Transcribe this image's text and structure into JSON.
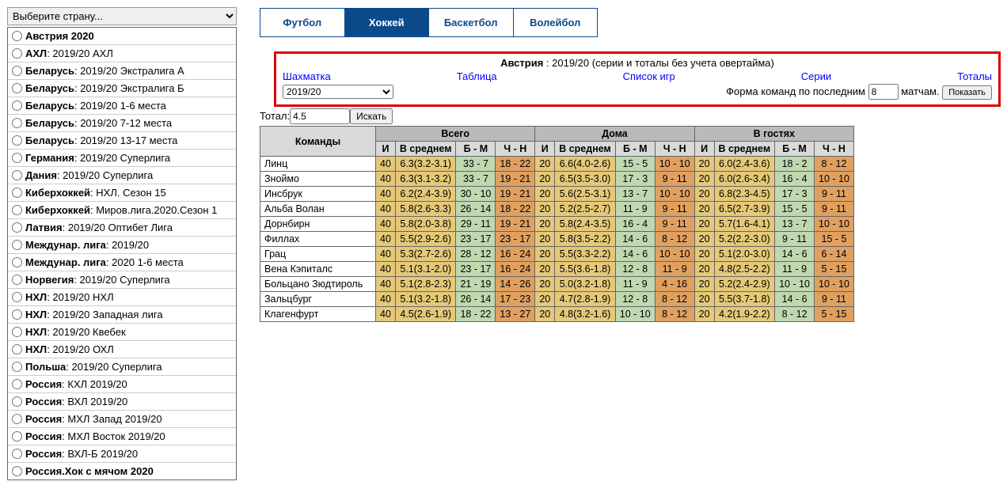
{
  "sidebar": {
    "dropdown": "Выберите страну...",
    "items": [
      {
        "b": "Австрия 2020",
        "rest": ""
      },
      {
        "b": "АХЛ",
        "rest": " : 2019/20 АХЛ"
      },
      {
        "b": "Беларусь",
        "rest": " : 2019/20 Экстралига А"
      },
      {
        "b": "Беларусь",
        "rest": " : 2019/20 Экстралига Б"
      },
      {
        "b": "Беларусь",
        "rest": " : 2019/20 1-6 места"
      },
      {
        "b": "Беларусь",
        "rest": " : 2019/20 7-12 места"
      },
      {
        "b": "Беларусь",
        "rest": " : 2019/20 13-17 места"
      },
      {
        "b": "Германия",
        "rest": " : 2019/20 Суперлига"
      },
      {
        "b": "Дания",
        "rest": " : 2019/20 Суперлига"
      },
      {
        "b": "Киберхоккей",
        "rest": " : НХЛ. Сезон 15"
      },
      {
        "b": "Киберхоккей",
        "rest": " : Миров.лига.2020.Сезон 1"
      },
      {
        "b": "Латвия",
        "rest": " : 2019/20 Оптибет Лига"
      },
      {
        "b": "Междунар. лига",
        "rest": " : 2019/20"
      },
      {
        "b": "Междунар. лига",
        "rest": " : 2020 1-6 места"
      },
      {
        "b": "Норвегия",
        "rest": " : 2019/20 Суперлига"
      },
      {
        "b": "НХЛ",
        "rest": " : 2019/20 НХЛ"
      },
      {
        "b": "НХЛ",
        "rest": " : 2019/20 Западная лига"
      },
      {
        "b": "НХЛ",
        "rest": " : 2019/20 Квебек"
      },
      {
        "b": "НХЛ",
        "rest": " : 2019/20 ОХЛ"
      },
      {
        "b": "Польша",
        "rest": " : 2019/20 Суперлига"
      },
      {
        "b": "Россия",
        "rest": " : КХЛ 2019/20"
      },
      {
        "b": "Россия",
        "rest": " : ВХЛ 2019/20"
      },
      {
        "b": "Россия",
        "rest": " : МХЛ Запад 2019/20"
      },
      {
        "b": "Россия",
        "rest": " : МХЛ Восток 2019/20"
      },
      {
        "b": "Россия",
        "rest": " : ВХЛ-Б 2019/20"
      },
      {
        "b": "Россия.Хок с мячом 2020",
        "rest": ""
      }
    ]
  },
  "tabs": {
    "football": "Футбол",
    "hockey": "Хоккей",
    "basketball": "Баскетбол",
    "volleyball": "Волейбол"
  },
  "ctrl": {
    "title_b": "Австрия",
    "title_rest": " : 2019/20 (серии и тоталы без учета овертайма)",
    "shakhmatka": "Шахматка",
    "table": "Таблица",
    "list": "Список игр",
    "series": "Серии",
    "totals": "Тоталы",
    "season": "2019/20",
    "form_prefix": "Форма команд по последним ",
    "form_value": "8",
    "form_suffix": " матчам. ",
    "show": "Показать"
  },
  "totbar": {
    "label": "Тотал:",
    "value": "4.5",
    "search": "Искать"
  },
  "table": {
    "group": [
      "Всего",
      "Дома",
      "В гостях"
    ],
    "sub": [
      "Команды",
      "И",
      "В среднем",
      "Б - М",
      "Ч - Н",
      "И",
      "В среднем",
      "Б - М",
      "Ч - Н",
      "И",
      "В среднем",
      "Б - М",
      "Ч - Н"
    ],
    "rows": [
      {
        "name": "Линц",
        "all": {
          "i": "40",
          "avg": "6.3(3.2-3.1)",
          "bm": "33 - 7",
          "chn": "18 - 22"
        },
        "home": {
          "i": "20",
          "avg": "6.6(4.0-2.6)",
          "bm": "15 - 5",
          "chn": "10 - 10"
        },
        "away": {
          "i": "20",
          "avg": "6.0(2.4-3.6)",
          "bm": "18 - 2",
          "chn": "8 - 12"
        }
      },
      {
        "name": "Зноймо",
        "all": {
          "i": "40",
          "avg": "6.3(3.1-3.2)",
          "bm": "33 - 7",
          "chn": "19 - 21"
        },
        "home": {
          "i": "20",
          "avg": "6.5(3.5-3.0)",
          "bm": "17 - 3",
          "chn": "9 - 11"
        },
        "away": {
          "i": "20",
          "avg": "6.0(2.6-3.4)",
          "bm": "16 - 4",
          "chn": "10 - 10"
        }
      },
      {
        "name": "Инсбрук",
        "all": {
          "i": "40",
          "avg": "6.2(2.4-3.9)",
          "bm": "30 - 10",
          "chn": "19 - 21"
        },
        "home": {
          "i": "20",
          "avg": "5.6(2.5-3.1)",
          "bm": "13 - 7",
          "chn": "10 - 10"
        },
        "away": {
          "i": "20",
          "avg": "6.8(2.3-4.5)",
          "bm": "17 - 3",
          "chn": "9 - 11"
        }
      },
      {
        "name": "Альба Волан",
        "all": {
          "i": "40",
          "avg": "5.8(2.6-3.3)",
          "bm": "26 - 14",
          "chn": "18 - 22"
        },
        "home": {
          "i": "20",
          "avg": "5.2(2.5-2.7)",
          "bm": "11 - 9",
          "chn": "9 - 11"
        },
        "away": {
          "i": "20",
          "avg": "6.5(2.7-3.9)",
          "bm": "15 - 5",
          "chn": "9 - 11"
        }
      },
      {
        "name": "Дорнбирн",
        "all": {
          "i": "40",
          "avg": "5.8(2.0-3.8)",
          "bm": "29 - 11",
          "chn": "19 - 21"
        },
        "home": {
          "i": "20",
          "avg": "5.8(2.4-3.5)",
          "bm": "16 - 4",
          "chn": "9 - 11"
        },
        "away": {
          "i": "20",
          "avg": "5.7(1.6-4.1)",
          "bm": "13 - 7",
          "chn": "10 - 10"
        }
      },
      {
        "name": "Филлах",
        "all": {
          "i": "40",
          "avg": "5.5(2.9-2.6)",
          "bm": "23 - 17",
          "chn": "23 - 17"
        },
        "home": {
          "i": "20",
          "avg": "5.8(3.5-2.2)",
          "bm": "14 - 6",
          "chn": "8 - 12"
        },
        "away": {
          "i": "20",
          "avg": "5.2(2.2-3.0)",
          "bm": "9 - 11",
          "chn": "15 - 5"
        }
      },
      {
        "name": "Грац",
        "all": {
          "i": "40",
          "avg": "5.3(2.7-2.6)",
          "bm": "28 - 12",
          "chn": "16 - 24"
        },
        "home": {
          "i": "20",
          "avg": "5.5(3.3-2.2)",
          "bm": "14 - 6",
          "chn": "10 - 10"
        },
        "away": {
          "i": "20",
          "avg": "5.1(2.0-3.0)",
          "bm": "14 - 6",
          "chn": "6 - 14"
        }
      },
      {
        "name": "Вена Кэпиталс",
        "all": {
          "i": "40",
          "avg": "5.1(3.1-2.0)",
          "bm": "23 - 17",
          "chn": "16 - 24"
        },
        "home": {
          "i": "20",
          "avg": "5.5(3.6-1.8)",
          "bm": "12 - 8",
          "chn": "11 - 9"
        },
        "away": {
          "i": "20",
          "avg": "4.8(2.5-2.2)",
          "bm": "11 - 9",
          "chn": "5 - 15"
        }
      },
      {
        "name": "Больцано Зюдтироль",
        "all": {
          "i": "40",
          "avg": "5.1(2.8-2.3)",
          "bm": "21 - 19",
          "chn": "14 - 26"
        },
        "home": {
          "i": "20",
          "avg": "5.0(3.2-1.8)",
          "bm": "11 - 9",
          "chn": "4 - 16"
        },
        "away": {
          "i": "20",
          "avg": "5.2(2.4-2.9)",
          "bm": "10 - 10",
          "chn": "10 - 10"
        }
      },
      {
        "name": "Зальцбург",
        "all": {
          "i": "40",
          "avg": "5.1(3.2-1.8)",
          "bm": "26 - 14",
          "chn": "17 - 23"
        },
        "home": {
          "i": "20",
          "avg": "4.7(2.8-1.9)",
          "bm": "12 - 8",
          "chn": "8 - 12"
        },
        "away": {
          "i": "20",
          "avg": "5.5(3.7-1.8)",
          "bm": "14 - 6",
          "chn": "9 - 11"
        }
      },
      {
        "name": "Клагенфурт",
        "all": {
          "i": "40",
          "avg": "4.5(2.6-1.9)",
          "bm": "18 - 22",
          "chn": "13 - 27"
        },
        "home": {
          "i": "20",
          "avg": "4.8(3.2-1.6)",
          "bm": "10 - 10",
          "chn": "8 - 12"
        },
        "away": {
          "i": "20",
          "avg": "4.2(1.9-2.2)",
          "bm": "8 - 12",
          "chn": "5 - 15"
        }
      }
    ]
  }
}
